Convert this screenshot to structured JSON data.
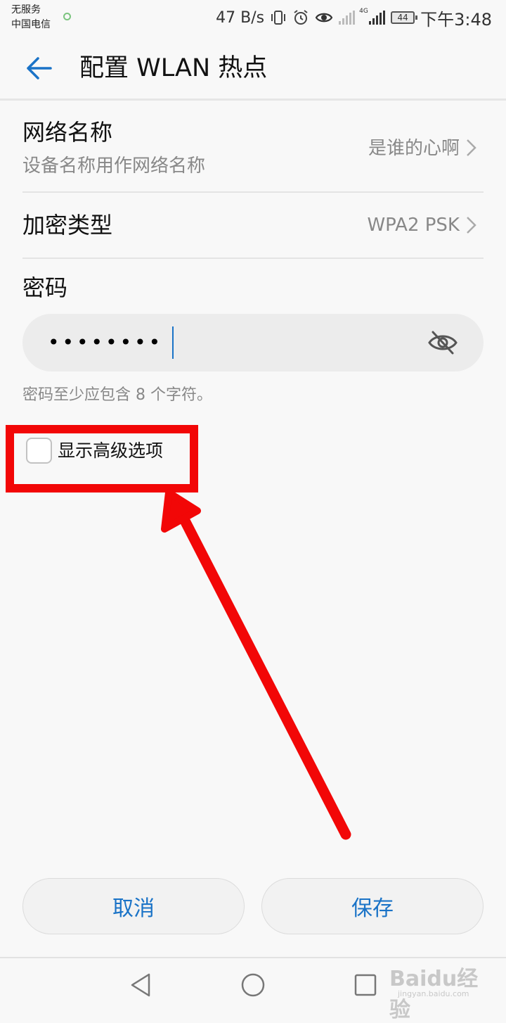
{
  "status_bar": {
    "carrier_line1": "无服务",
    "carrier_line2": "中国电信",
    "net_speed": "47 B/s",
    "network_type": "4G",
    "battery_level": "44",
    "time": "下午3:48",
    "icons": [
      "vibrate-icon",
      "alarm-icon",
      "eye-comfort-icon",
      "signal-x-icon",
      "signal-4g-icon",
      "battery-icon"
    ]
  },
  "header": {
    "title": "配置 WLAN 热点",
    "back_icon": "arrow-left-icon"
  },
  "settings": {
    "network_name": {
      "title": "网络名称",
      "subtitle": "设备名称用作网络名称",
      "value": "是谁的心啊"
    },
    "encryption": {
      "title": "加密类型",
      "value": "WPA2 PSK"
    },
    "password": {
      "label": "密码",
      "masked_value": "••••••••",
      "hint": "密码至少应包含 8 个字符。",
      "toggle_icon": "eye-off-icon"
    },
    "advanced": {
      "label": "显示高级选项",
      "checked": false
    }
  },
  "buttons": {
    "cancel": "取消",
    "save": "保存"
  },
  "nav": {
    "icons": [
      "back-triangle-icon",
      "home-circle-icon",
      "recents-square-icon"
    ]
  },
  "watermark": {
    "main": "Baidu经验",
    "sub": "jingyan.baidu.com"
  },
  "colors": {
    "accent": "#1a73c7",
    "annotation": "#f20707",
    "background": "#f8f8f8"
  }
}
